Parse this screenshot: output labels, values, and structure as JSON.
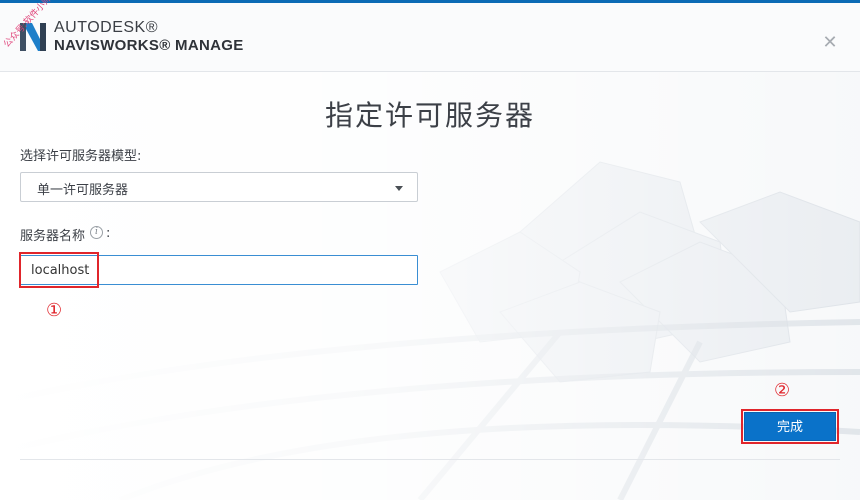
{
  "header": {
    "brand_line1": "AUTODESK®",
    "brand_line2": "NAVISWORKS® MANAGE",
    "watermark": "公众号:软件小帅"
  },
  "dialog": {
    "title": "指定许可服务器",
    "server_model_label": "选择许可服务器模型:",
    "server_model_value": "单一许可服务器",
    "server_name_label": "服务器名称",
    "server_name_colon": ":",
    "server_name_value": "localhost",
    "finish_label": "完成"
  },
  "annotations": {
    "marker1": "①",
    "marker2": "②"
  },
  "icons": {
    "logo": "navisworks-n-logo",
    "close": "close-icon",
    "info": "info-icon",
    "dropdown": "chevron-down-icon"
  },
  "colors": {
    "accent": "#0a72c9",
    "annotation": "#e0252b",
    "top_bar": "#0b6bb5"
  }
}
